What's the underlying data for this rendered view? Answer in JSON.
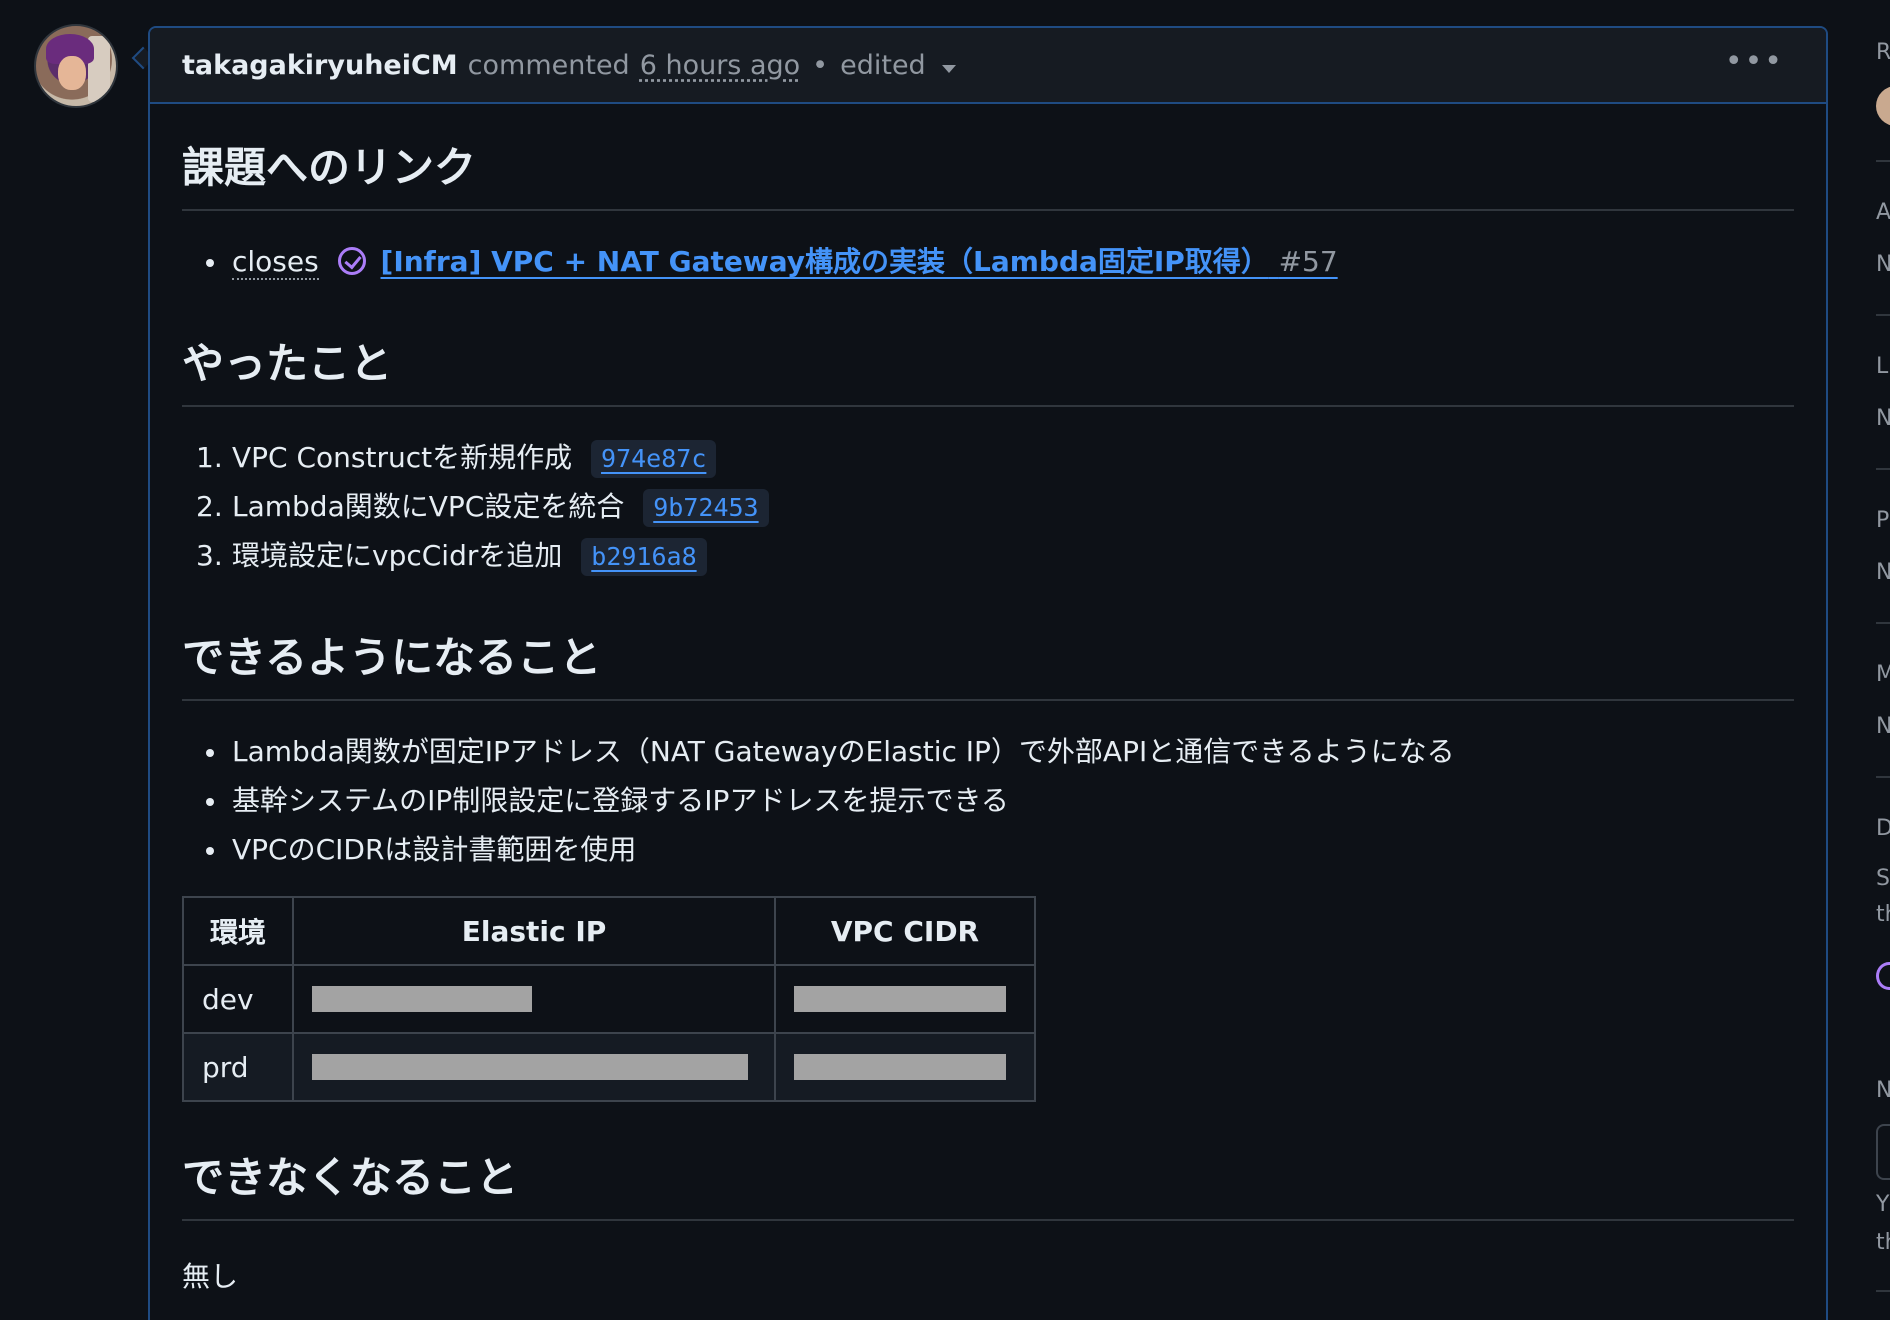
{
  "comment": {
    "author": "takagakiryuheiCM",
    "action": "commented",
    "time_ago": "6 hours ago",
    "separator": "•",
    "edited_label": "edited",
    "menu_icon": "kebab-horizontal-icon"
  },
  "sections": {
    "link": {
      "heading": "課題へのリンク",
      "closes_label": "closes",
      "issue_title": "[Infra] VPC + NAT Gateway構成の実装（Lambda固定IP取得）",
      "issue_number": "#57",
      "issue_icon": "issue-closed-icon"
    },
    "done": {
      "heading": "やったこと",
      "items": [
        {
          "num": "1.",
          "text": "VPC Constructを新規作成",
          "sha": "974e87c"
        },
        {
          "num": "2.",
          "text": "Lambda関数にVPC設定を統合",
          "sha": "9b72453"
        },
        {
          "num": "3.",
          "text": "環境設定にvpcCidrを追加",
          "sha": "b2916a8"
        }
      ]
    },
    "can": {
      "heading": "できるようになること",
      "items": [
        "Lambda関数が固定IPアドレス（NAT GatewayのElastic IP）で外部APIと通信できるようになる",
        "基幹システムのIP制限設定に登録するIPアドレスを提示できる",
        "VPCのCIDRは設計書範囲を使用"
      ],
      "table": {
        "headers": [
          "環境",
          "Elastic IP",
          "VPC CIDR"
        ],
        "rows": [
          {
            "env": "dev",
            "elastic_ip": "[redacted]",
            "vpc_cidr": "[redacted]"
          },
          {
            "env": "prd",
            "elastic_ip": "[redacted]",
            "vpc_cidr": "[redacted]"
          }
        ]
      }
    },
    "cannot": {
      "heading": "できなくなること",
      "body": "無し"
    }
  },
  "colors": {
    "background": "#0d1117",
    "header_bg": "#161b22",
    "accent_border": "#1f4b82",
    "link": "#4493f8",
    "closed_purple": "#ab7df8",
    "muted": "#9198a1"
  },
  "sidebar": {
    "letters": [
      "R",
      "A",
      "N",
      "L",
      "N",
      "P",
      "N",
      "M",
      "N",
      "D",
      "S",
      "th",
      "N",
      "Y",
      "th"
    ]
  }
}
